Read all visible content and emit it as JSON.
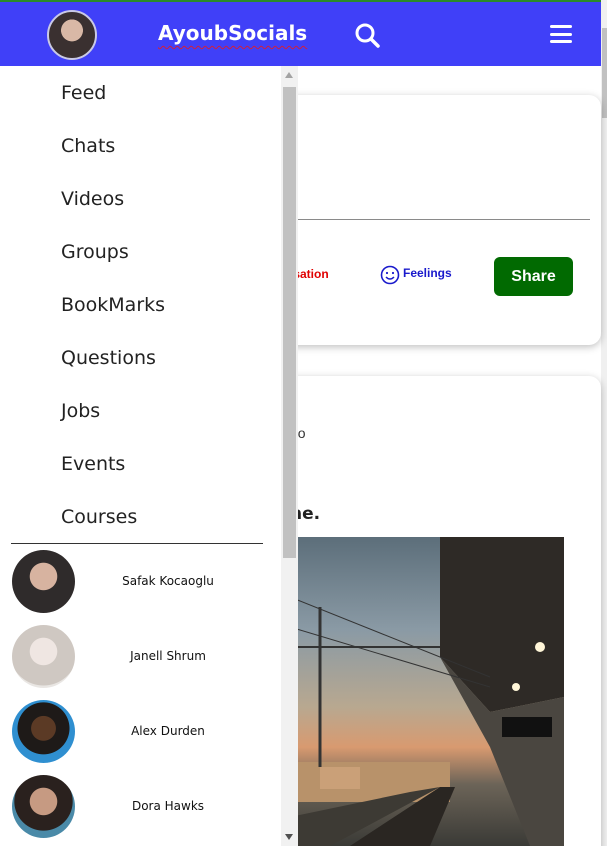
{
  "header": {
    "brand": "AyoubSocials"
  },
  "nav": {
    "items": [
      "Feed",
      "Chats",
      "Videos",
      "Groups",
      "BookMarks",
      "Questions",
      "Jobs",
      "Events",
      "Courses"
    ]
  },
  "friends": [
    {
      "name": "Safak Kocaoglu"
    },
    {
      "name": "Janell Shrum"
    },
    {
      "name": "Alex Durden"
    },
    {
      "name": "Dora Hawks"
    }
  ],
  "composer": {
    "location_label": "isation",
    "feelings_label": "Feelings",
    "share_label": "Share"
  },
  "post": {
    "time_fragment": "go",
    "title_fragment": "ne."
  },
  "colors": {
    "header_bg": "#4040f8",
    "share_bg": "#016a01",
    "location_text": "#e00000",
    "feelings_text": "#1a1acc"
  },
  "icons": {
    "search": "search-icon",
    "menu": "hamburger-menu-icon",
    "feelings": "smiley-icon"
  }
}
